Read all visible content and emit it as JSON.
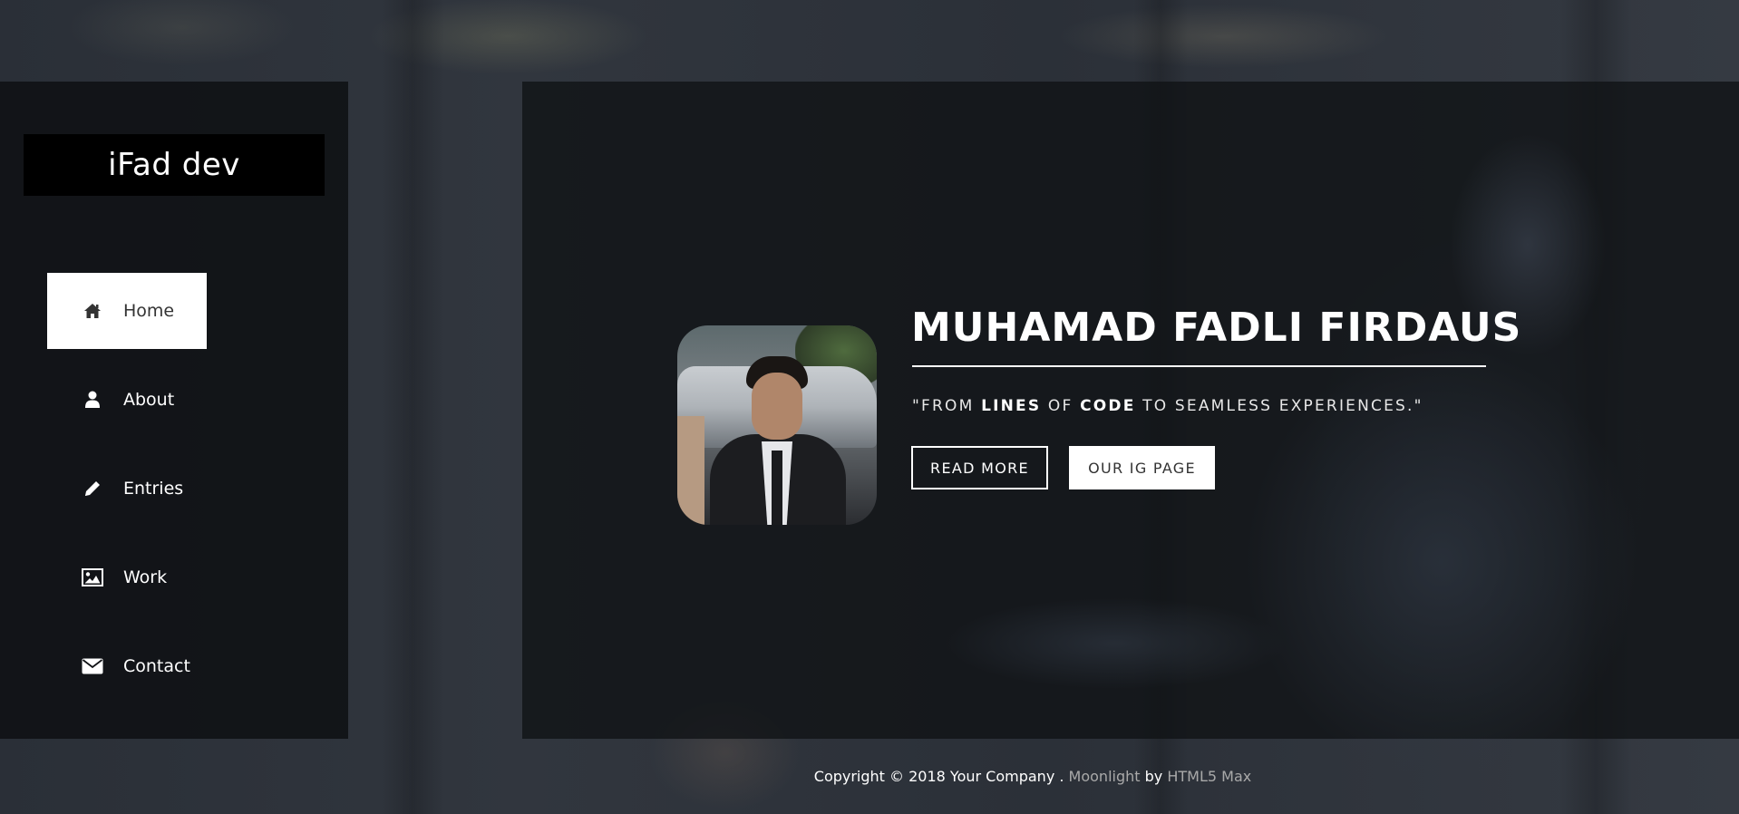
{
  "brand": {
    "logo_text": "iFad dev"
  },
  "sidebar": {
    "items": [
      {
        "label": "Home",
        "icon": "home-icon",
        "active": true
      },
      {
        "label": "About",
        "icon": "user-icon",
        "active": false
      },
      {
        "label": "Entries",
        "icon": "pencil-icon",
        "active": false
      },
      {
        "label": "Work",
        "icon": "image-icon",
        "active": false
      },
      {
        "label": "Contact",
        "icon": "envelope-icon",
        "active": false
      }
    ]
  },
  "hero": {
    "name": "MUHAMAD FADLI FIRDAUS",
    "tagline_parts": [
      "\"FROM ",
      "LINES",
      " OF ",
      "CODE",
      " TO SEAMLESS EXPERIENCES.\""
    ],
    "read_more_label": "READ MORE",
    "ig_label": "OUR IG PAGE"
  },
  "footer": {
    "copyright": "Copyright © 2018 Your Company .",
    "theme_link": "Moonlight",
    "by": "by",
    "author_link": "HTML5 Max"
  },
  "colors": {
    "panel": "#101215",
    "accent_white": "#ffffff",
    "link_muted": "#a9a9a9"
  }
}
